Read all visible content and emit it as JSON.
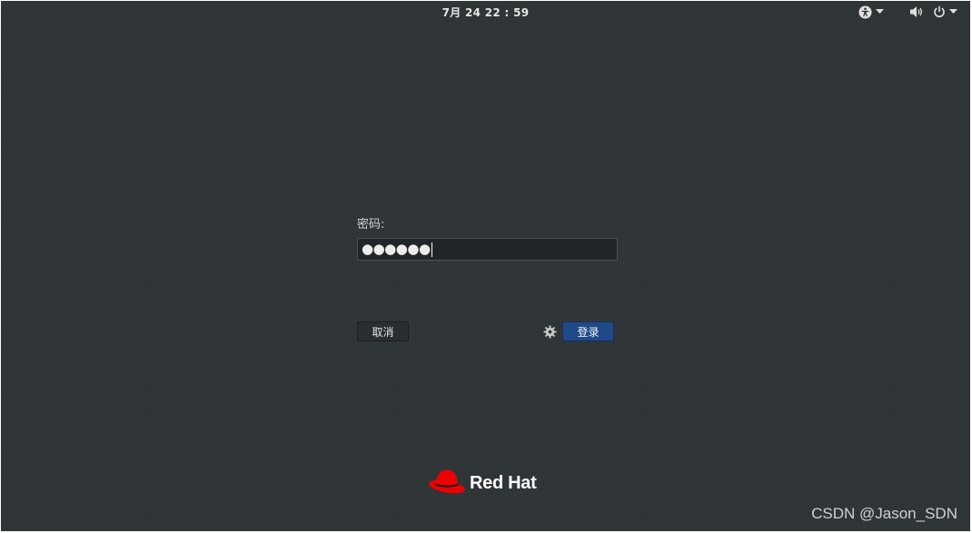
{
  "topbar": {
    "clock": "7月 24  22 : 59",
    "icons": [
      "accessibility-icon",
      "chevron-down-icon",
      "volume-icon",
      "power-icon",
      "chevron-down-icon"
    ]
  },
  "login": {
    "password_label": "密码:",
    "password_value_masked": "●●●●●●",
    "cancel_label": "取消",
    "login_label": "登录",
    "accent_color": "#204a87"
  },
  "branding": {
    "logo_text": "Red Hat",
    "logo_color": "#ee0000"
  },
  "watermark": {
    "text": "CSDN @Jason_SDN"
  }
}
